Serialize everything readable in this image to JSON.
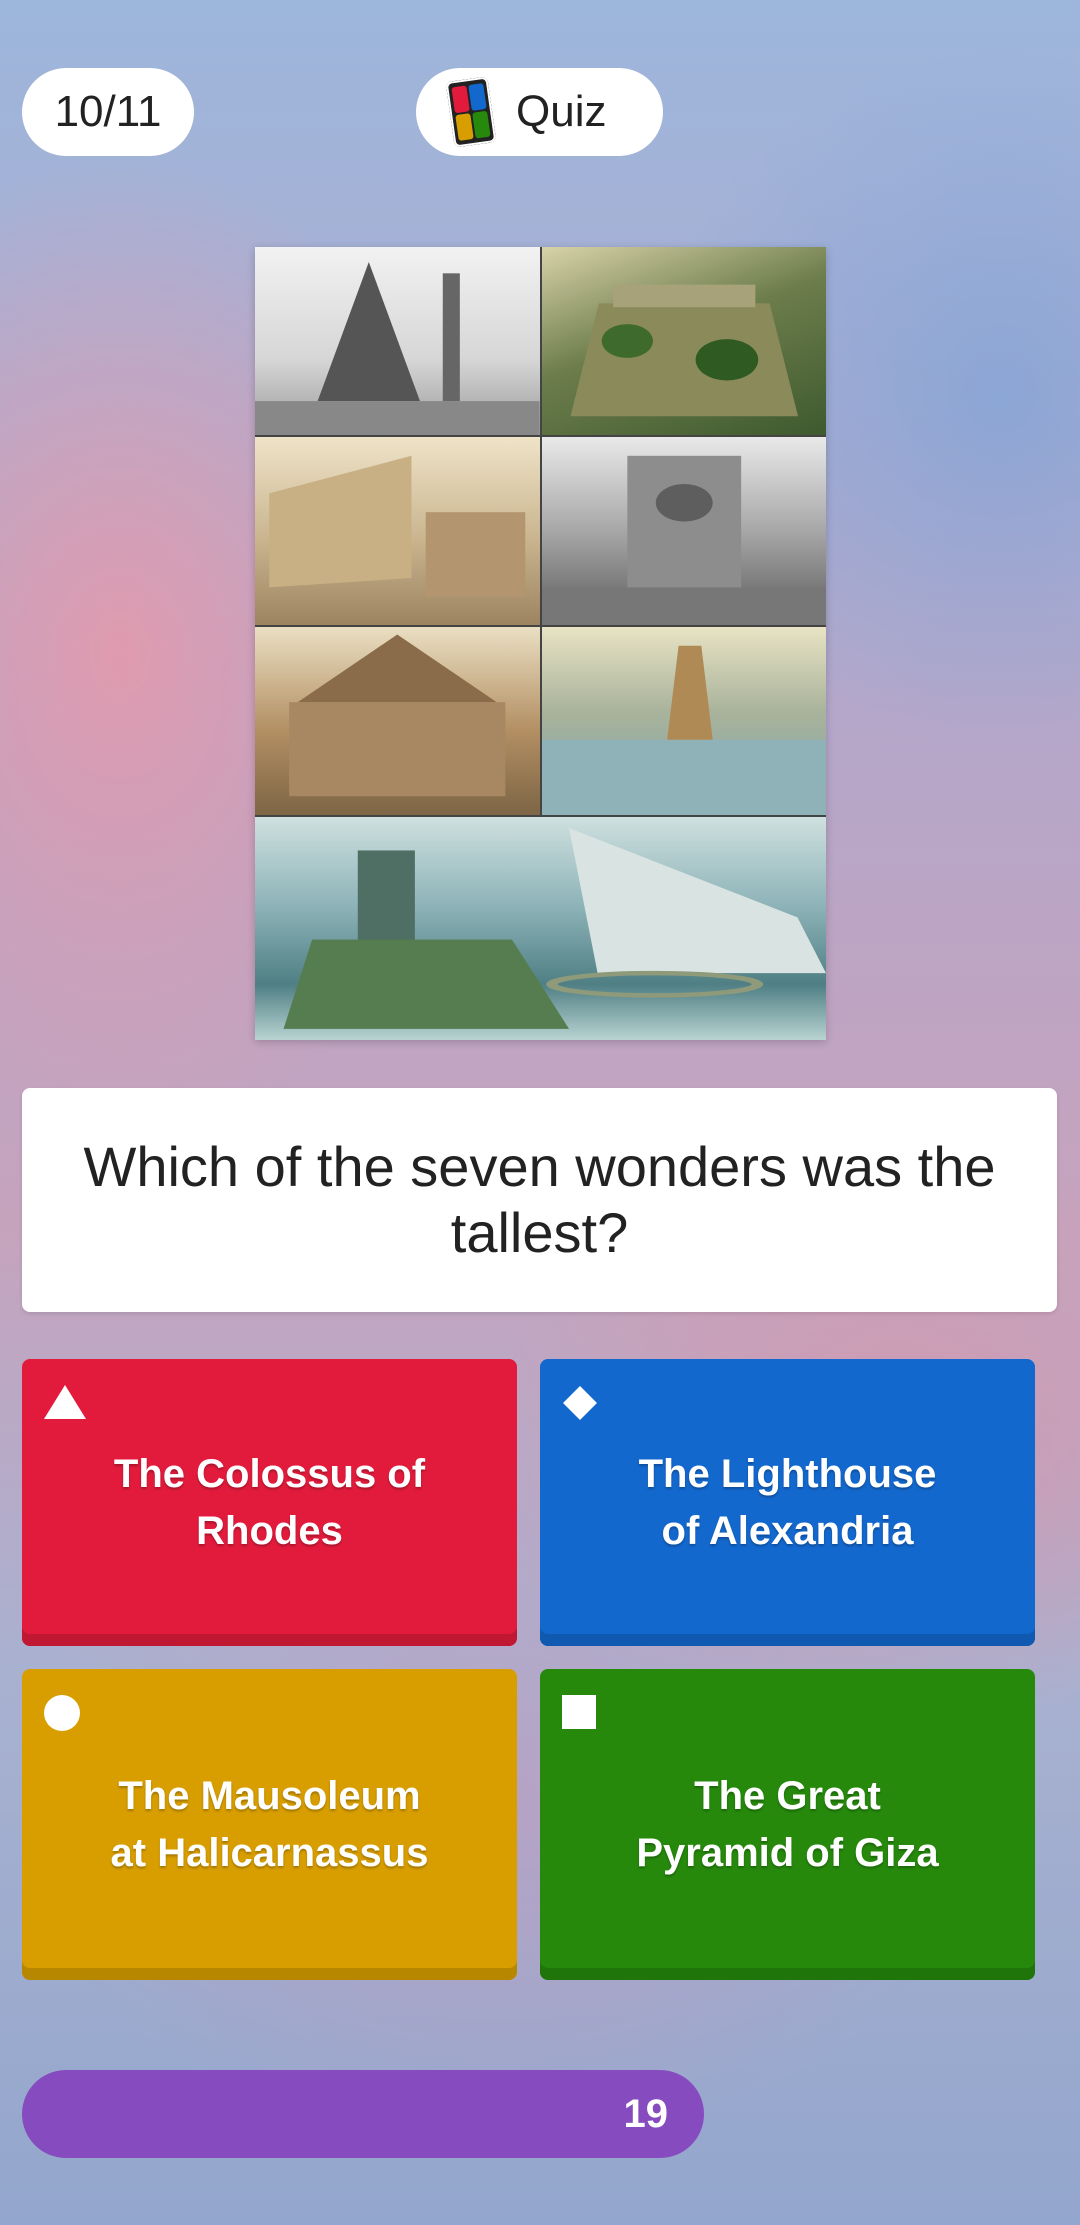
{
  "header": {
    "question_counter": "10/11",
    "brand_label": "Quiz",
    "brand_icon": "quiz-logo-icon"
  },
  "question": {
    "text": "Which of the seven wonders was the tallest?"
  },
  "answers": [
    {
      "label": "The Colossus of Rhodes",
      "shape": "triangle-icon",
      "color": "#e21b3c"
    },
    {
      "label": "The Lighthouse of Alexandria",
      "shape": "diamond-icon",
      "color": "#1368ce"
    },
    {
      "label": "The Mausoleum at Halicarnassus",
      "shape": "circle-icon",
      "color": "#d89e00"
    },
    {
      "label": "The Great Pyramid of Giza",
      "shape": "square-icon",
      "color": "#26890c"
    }
  ],
  "timer": {
    "value": "19",
    "color": "#864cbf"
  },
  "colors": {
    "red": "#e21b3c",
    "blue": "#1368ce",
    "yellow": "#d89e00",
    "green": "#26890c",
    "purple": "#864cbf"
  }
}
